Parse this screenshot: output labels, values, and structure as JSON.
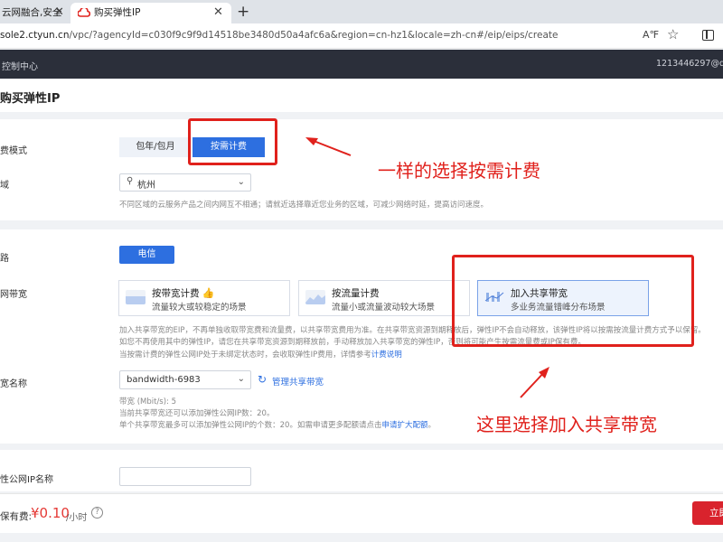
{
  "browser": {
    "tab1_title": "云网融合,安全",
    "tab2_title": "购买弹性IP",
    "url_host": "sole2.ctyun.cn",
    "url_path": "/vpc/?agencyId=c030f9c9f9d14518be3480d50a4afc6a&region=cn-hz1&locale=zh-cn#/eip/eips/create",
    "read_aloud_label": "A℉"
  },
  "header": {
    "console": "控制中心",
    "account": "1213446297@qq.co"
  },
  "page": {
    "title": "购买弹性IP"
  },
  "billing": {
    "label": "费模式",
    "options": [
      "包年/包月",
      "按需计费"
    ],
    "selected": "按需计费"
  },
  "region": {
    "label": "域",
    "value": "杭州",
    "hint": "不同区域的云服务产品之间内网互不相通；请就近选择靠近您业务的区域，可减少网络时延，提高访问速度。"
  },
  "line": {
    "label": "路",
    "value": "电信"
  },
  "bandwidth": {
    "label": "网带宽",
    "options": [
      {
        "title": "按带宽计费",
        "desc": "流量较大或较稳定的场景"
      },
      {
        "title": "按流量计费",
        "desc": "流量小或流量波动较大场景"
      },
      {
        "title": "加入共享带宽",
        "desc": "多业务流量错峰分布场景"
      }
    ],
    "selected": "加入共享带宽",
    "note1": "加入共享带宽的EIP，不再单独收取带宽费和流量费，以共享带宽费用为准。在共享带宽资源到期释放后，弹性IP不会自动释放，该弹性IP将以按需按流量计费方式予以保留。",
    "note2": "如您不再使用其中的弹性IP，请您在共享带宽资源到期释放前，手动释放加入共享带宽的弹性IP，否则将可能产生按需流量费或IP保有费。",
    "note3_prefix": "当按需计费的弹性公网IP处于未绑定状态时，会收取弹性IP费用，详情参考",
    "note3_link": "计费说明"
  },
  "shared": {
    "label": "宽名称",
    "value": "bandwidth-6983",
    "manage": "管理共享带宽",
    "info1": "带宽 (Mbit/s): 5",
    "info2": "当前共享带宽还可以添加弹性公网IP数：20。",
    "info3_prefix": "单个共享带宽最多可以添加弹性公网IP的个数：20。如需申请更多配额请点击",
    "info3_link": "申请扩大配额",
    "info3_suffix": "。"
  },
  "eip_name": {
    "label": "性公网IP名称",
    "value": ""
  },
  "footer": {
    "fee_label": "保有费:",
    "fee_value": "¥0.10",
    "fee_unit": "/小时",
    "buy": "立即"
  },
  "annotations": {
    "text1": "一样的选择按需计费",
    "text2": "这里选择加入共享带宽"
  },
  "colors": {
    "primary": "#2d6fe0",
    "annotation": "#e0211c",
    "price": "#e53935"
  }
}
